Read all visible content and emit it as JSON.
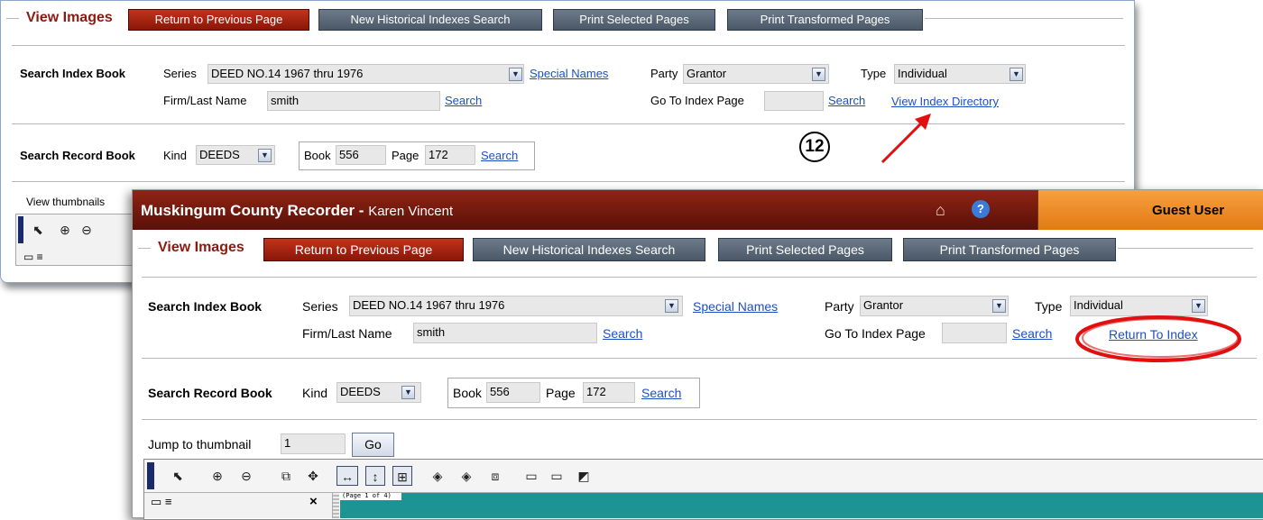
{
  "back": {
    "legend": "View Images",
    "buttons": {
      "return": "Return to Previous Page",
      "new_search": "New Historical Indexes Search",
      "print_selected": "Print Selected Pages",
      "print_transformed": "Print Transformed Pages"
    },
    "index": {
      "label": "Search Index Book",
      "series_label": "Series",
      "series_value": "DEED NO.14 1967 thru 1976",
      "special_names": "Special Names",
      "party_label": "Party",
      "party_value": "Grantor",
      "type_label": "Type",
      "type_value": "Individual",
      "firm_label": "Firm/Last Name",
      "firm_value": "smith",
      "search": "Search",
      "goto_label": "Go To Index Page",
      "goto_value": "",
      "goto_search": "Search",
      "view_directory": "View Index Directory"
    },
    "record": {
      "label": "Search Record Book",
      "kind_label": "Kind",
      "kind_value": "DEEDS",
      "book_label": "Book",
      "book_value": "556",
      "page_label": "Page",
      "page_value": "172",
      "search": "Search"
    },
    "thumbs_label": "View thumbnails"
  },
  "step_marker": "12",
  "front": {
    "header": {
      "title": "Muskingum County Recorder -",
      "user_name": "Karen Vincent",
      "guest": "Guest User",
      "help": "?"
    },
    "legend": "View Images",
    "buttons": {
      "return": "Return to Previous Page",
      "new_search": "New Historical Indexes Search",
      "print_selected": "Print Selected Pages",
      "print_transformed": "Print Transformed Pages"
    },
    "index": {
      "label": "Search Index Book",
      "series_label": "Series",
      "series_value": "DEED NO.14 1967 thru 1976",
      "special_names": "Special Names",
      "party_label": "Party",
      "party_value": "Grantor",
      "type_label": "Type",
      "type_value": "Individual",
      "firm_label": "Firm/Last Name",
      "firm_value": "smith",
      "search": "Search",
      "goto_label": "Go To Index Page",
      "goto_value": "",
      "goto_search": "Search",
      "return_index": "Return To Index"
    },
    "record": {
      "label": "Search Record Book",
      "kind_label": "Kind",
      "kind_value": "DEEDS",
      "book_label": "Book",
      "book_value": "556",
      "page_label": "Page",
      "page_value": "172",
      "search": "Search"
    },
    "jump": {
      "label": "Jump to thumbnail",
      "value": "1",
      "go": "Go"
    },
    "viewer": {
      "page_indicator": "(Page 1 of 4)",
      "close": "×"
    }
  },
  "colors": {
    "header_red": "#8b1a10",
    "guest_orange": "#f08a1c",
    "link_blue": "#1d4fc4",
    "viewer_teal": "#1d9494",
    "annotation_red": "#e01010"
  }
}
